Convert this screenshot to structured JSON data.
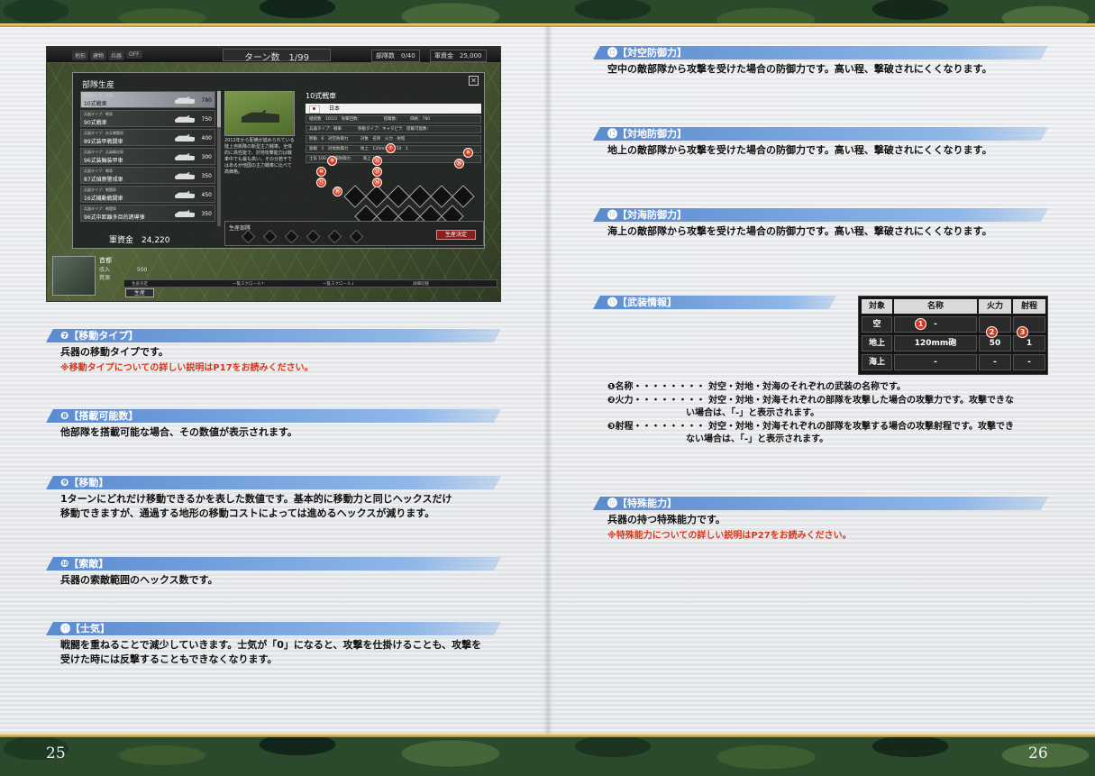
{
  "page": {
    "left_number": "25",
    "right_number": "26"
  },
  "screenshot": {
    "top_bar": {
      "mode_buttons": [
        "地形",
        "建物",
        "兵器",
        "OFF"
      ],
      "turn_label": "ターン数　1/99",
      "unit_count": "部隊数　0/40",
      "funds": "軍資金　25,000"
    },
    "dialog": {
      "title": "部隊生産",
      "close_glyph": "✕",
      "units": [
        {
          "type": "兵器タイプ：戦車",
          "name": "10式戦車",
          "cost": "780",
          "selected": true
        },
        {
          "type": "兵器タイプ：戦車",
          "name": "90式戦車",
          "cost": "750",
          "selected": false
        },
        {
          "type": "兵器タイプ：歩兵戦闘車",
          "name": "89式装甲戦闘車",
          "cost": "400",
          "selected": false
        },
        {
          "type": "兵器タイプ：兵員輸送車",
          "name": "96式装輪装甲車",
          "cost": "300",
          "selected": false
        },
        {
          "type": "兵器タイプ：戦車",
          "name": "87式偵察警戒車",
          "cost": "350",
          "selected": false
        },
        {
          "type": "兵器タイプ：戦闘車",
          "name": "16式機動戦闘車",
          "cost": "450",
          "selected": false
        },
        {
          "type": "兵器タイプ：戦闘車",
          "name": "96式中距離多目的誘導弾",
          "cost": "350",
          "selected": false
        }
      ],
      "funds": "軍資金　24,220",
      "unit_name": "10式戦車",
      "nation": "日本",
      "stats_rows": [
        "継続数　10/10　攻撃回数：　　　　　　搭載数：　　　価格：780",
        "兵器タイプ：戦車　　　　移動タイプ：キャタピラ　搭載可能数：",
        "移動　6　対空防御力　　　対象　名称　火力　射程",
        "索敵　1　対地防御力　　　地上　120mm砲　50　1",
        "士気 100　対海防御力　　　海上"
      ],
      "description": "2012年から配備が進められている陸上自衛隊の新型主力戦車。全体的に高性能で、対地攻撃能力は戦車中でも最も高い。その分若干ではあるが他国の主力戦車に比べて高価格。",
      "produced_label": "生産部隊",
      "produce_button": "生産決定",
      "markers": [
        "⑦",
        "⑧",
        "⑨",
        "⑩",
        "⑪",
        "⑫",
        "⑬",
        "⑭",
        "⑮",
        "⑯"
      ]
    },
    "hq": {
      "name": "首都",
      "income_label": "収入",
      "income_value": "500",
      "supply_label": "資源"
    },
    "bottom_bar": [
      "生産決定",
      "一覧スクロール↑",
      "一覧スクロール↓",
      "詳細切替"
    ],
    "produce_tab": "生産"
  },
  "left_sections": [
    {
      "title": "❼【移動タイプ】",
      "lines": [
        "兵器の移動タイプです。"
      ],
      "note": "※移動タイプについての詳しい説明はP17をお読みください。"
    },
    {
      "title": "❽【搭載可能数】",
      "lines": [
        "他部隊を搭載可能な場合、その数値が表示されます。"
      ],
      "note": ""
    },
    {
      "title": "❾【移動】",
      "lines": [
        "1ターンにどれだけ移動できるかを表した数値です。基本的に移動力と同じヘックスだけ",
        "移動できますが、通過する地形の移動コストによっては進めるヘックスが減ります。"
      ],
      "note": ""
    },
    {
      "title": "❿【索敵】",
      "lines": [
        "兵器の索敵範囲のヘックス数です。"
      ],
      "note": ""
    },
    {
      "title": "⓫【士気】",
      "lines": [
        "戦闘を重ねることで減少していきます。士気が「0」になると、攻撃を仕掛けることも、攻撃を",
        "受けた時には反撃することもできなくなります。"
      ],
      "note": ""
    }
  ],
  "right_sections": [
    {
      "title": "⓬【対空防御力】",
      "lines": [
        "空中の敵部隊から攻撃を受けた場合の防御力です。高い程、撃破されにくくなります。"
      ],
      "note": ""
    },
    {
      "title": "⓭【対地防御力】",
      "lines": [
        "地上の敵部隊から攻撃を受けた場合の防御力です。高い程、撃破されにくくなります。"
      ],
      "note": ""
    },
    {
      "title": "⓮【対海防御力】",
      "lines": [
        "海上の敵部隊から攻撃を受けた場合の防御力です。高い程、撃破されにくくなります。"
      ],
      "note": ""
    },
    {
      "title": "⓯【武装情報】",
      "lines": [],
      "note": ""
    },
    {
      "title": "⓰【特殊能力】",
      "lines": [
        "兵器の持つ特殊能力です。"
      ],
      "note": "※特殊能力についての詳しい説明はP27をお読みください。"
    }
  ],
  "weapon_table": {
    "headers": [
      "対象",
      "名称",
      "火力",
      "射程"
    ],
    "rows": [
      {
        "target": "空",
        "name": "-",
        "power": "",
        "range": ""
      },
      {
        "target": "地上",
        "name": "120mm砲",
        "power": "50",
        "range": "1"
      },
      {
        "target": "海上",
        "name": "-",
        "power": "-",
        "range": "-"
      }
    ],
    "markers": [
      "1",
      "2",
      "3"
    ]
  },
  "legend": [
    {
      "label": "❶名称",
      "dots": "・・・・・・・・",
      "text": [
        "対空・対地・対海のそれぞれの武装の名称です。"
      ]
    },
    {
      "label": "❷火力",
      "dots": "・・・・・・・・",
      "text": [
        "対空・対地・対海それぞれの部隊を攻撃した場合の攻撃力です。攻撃できな",
        "い場合は、「-」と表示されます。"
      ]
    },
    {
      "label": "❸射程",
      "dots": "・・・・・・・・",
      "text": [
        "対空・対地・対海それぞれの部隊を攻撃する場合の攻撃射程です。攻撃でき",
        "ない場合は、「-」と表示されます。"
      ]
    }
  ],
  "colors": {
    "section_bar": "#6d9ad8",
    "note_red": "#d4381c",
    "marker_red": "#d0391f"
  }
}
